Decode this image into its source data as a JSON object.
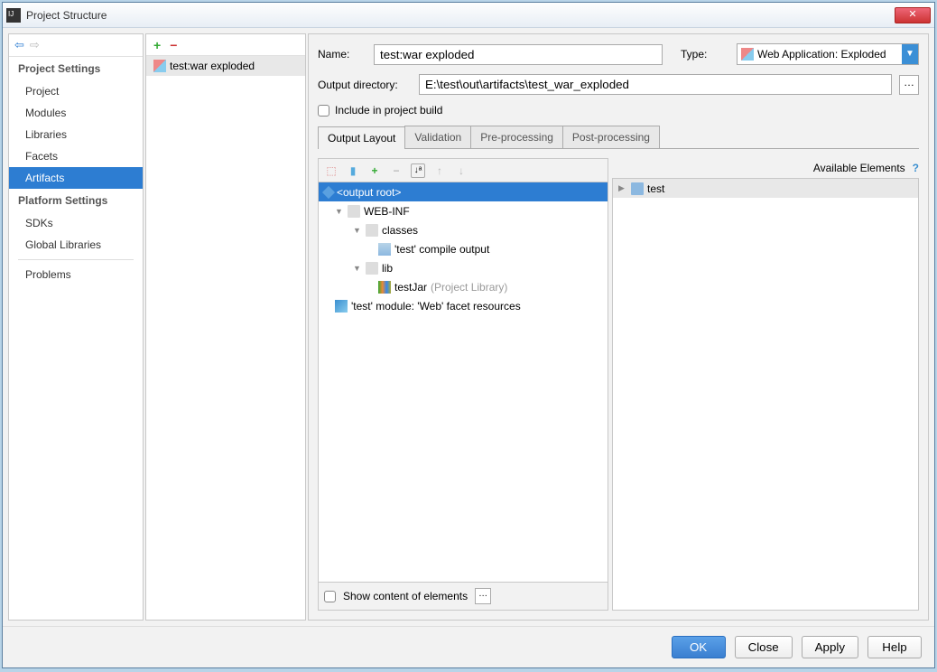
{
  "window": {
    "title": "Project Structure"
  },
  "sidebar": {
    "section1": "Project Settings",
    "items1": [
      "Project",
      "Modules",
      "Libraries",
      "Facets",
      "Artifacts"
    ],
    "selected1": 4,
    "section2": "Platform Settings",
    "items2": [
      "SDKs",
      "Global Libraries"
    ],
    "section3": "Problems"
  },
  "artifact_list": {
    "items": [
      "test:war exploded"
    ]
  },
  "form": {
    "name_label": "Name:",
    "name_value": "test:war exploded",
    "type_label": "Type:",
    "type_value": "Web Application: Exploded",
    "outdir_label": "Output directory:",
    "outdir_value": "E:\\test\\out\\artifacts\\test_war_exploded",
    "include_label": "Include in project build"
  },
  "tabs": [
    "Output Layout",
    "Validation",
    "Pre-processing",
    "Post-processing"
  ],
  "tree": {
    "root": "<output root>",
    "webinf": "WEB-INF",
    "classes": "classes",
    "compile_out": "'test' compile output",
    "lib": "lib",
    "testjar": "testJar",
    "testjar_suffix": "(Project Library)",
    "facet": "'test' module: 'Web' facet resources"
  },
  "available": {
    "header": "Available Elements",
    "items": [
      "test"
    ]
  },
  "footer": {
    "show_content": "Show content of elements"
  },
  "buttons": {
    "ok": "OK",
    "close": "Close",
    "apply": "Apply",
    "help": "Help"
  }
}
